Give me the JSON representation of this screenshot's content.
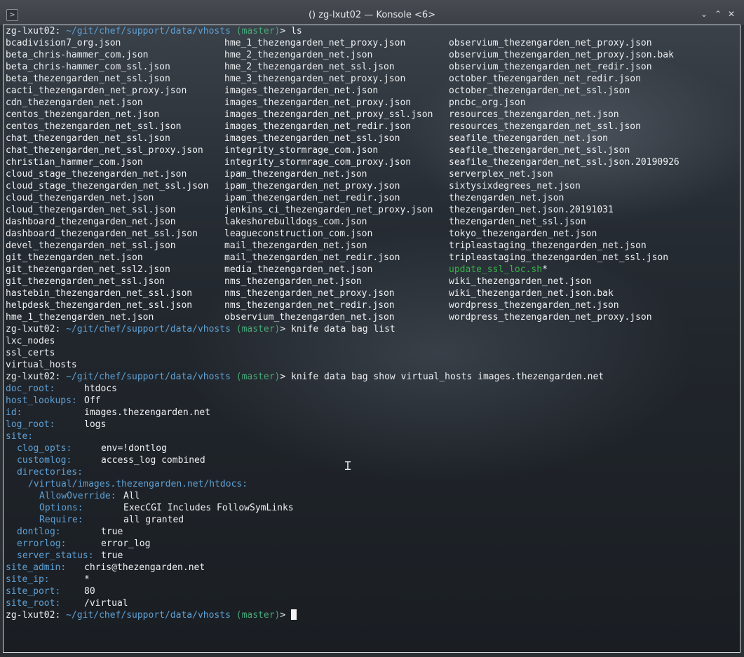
{
  "window": {
    "title": "() zg-lxut02 — Konsole <6>",
    "app_icon": "terminal-icon",
    "buttons": [
      "minimize-icon",
      "maximize-icon",
      "close-icon"
    ],
    "button_glyphs": [
      "⌄",
      "⌃",
      "✕"
    ]
  },
  "prompt": {
    "host": "zg-lxut02:",
    "path": "~/git/chef/support/data/vhosts",
    "branch": "(master)",
    "symbol": ">"
  },
  "commands": {
    "ls": "ls",
    "list": "knife data bag list",
    "show": "knife data bag show virtual_hosts images.thezengarden.net"
  },
  "ls_rows": [
    [
      "bcadivision7_org.json",
      "hme_1_thezengarden_net_proxy.json",
      "observium_thezengarden_net_proxy.json"
    ],
    [
      "beta_chris-hammer_com.json",
      "hme_2_thezengarden_net.json",
      "observium_thezengarden_net_proxy.json.bak"
    ],
    [
      "beta_chris-hammer_com_ssl.json",
      "hme_2_thezengarden_net_ssl.json",
      "observium_thezengarden_net_redir.json"
    ],
    [
      "beta_thezengarden_net_ssl.json",
      "hme_3_thezengarden_net_proxy.json",
      "october_thezengarden_net_redir.json"
    ],
    [
      "cacti_thezengarden_net_proxy.json",
      "images_thezengarden_net.json",
      "october_thezengarden_net_ssl.json"
    ],
    [
      "cdn_thezengarden_net.json",
      "images_thezengarden_net_proxy.json",
      "pncbc_org.json"
    ],
    [
      "centos_thezengarden_net.json",
      "images_thezengarden_net_proxy_ssl.json",
      "resources_thezengarden_net.json"
    ],
    [
      "centos_thezengarden_net_ssl.json",
      "images_thezengarden_net_redir.json",
      "resources_thezengarden_net_ssl.json"
    ],
    [
      "chat_thezengarden_net_ssl.json",
      "images_thezengarden_net_ssl.json",
      "seafile_thezengarden_net.json"
    ],
    [
      "chat_thezengarden_net_ssl_proxy.json",
      "integrity_stormrage_com.json",
      "seafile_thezengarden_net_ssl.json"
    ],
    [
      "christian_hammer_com.json",
      "integrity_stormrage_com_proxy.json",
      "seafile_thezengarden_net_ssl.json.20190926"
    ],
    [
      "cloud_stage_thezengarden_net.json",
      "ipam_thezengarden_net.json",
      "serverplex_net.json"
    ],
    [
      "cloud_stage_thezengarden_net_ssl.json",
      "ipam_thezengarden_net_proxy.json",
      "sixtysixdegrees_net.json"
    ],
    [
      "cloud_thezengarden_net.json",
      "ipam_thezengarden_net_redir.json",
      "thezengarden_net.json"
    ],
    [
      "cloud_thezengarden_net_ssl.json",
      "jenkins_ci_thezengarden_net_proxy.json",
      "thezengarden_net.json.20191031"
    ],
    [
      "dashboard_thezengarden_net.json",
      "lakeshorebulldogs_com.json",
      "thezengarden_net_ssl.json"
    ],
    [
      "dashboard_thezengarden_net_ssl.json",
      "leagueconstruction_com.json",
      "tokyo_thezengarden_net.json"
    ],
    [
      "devel_thezengarden_net_ssl.json",
      "mail_thezengarden_net.json",
      "tripleastaging_thezengarden_net.json"
    ],
    [
      "git_thezengarden_net.json",
      "mail_thezengarden_net_redir.json",
      "tripleastaging_thezengarden_net_ssl.json"
    ],
    [
      "git_thezengarden_net_ssl2.json",
      "media_thezengarden_net.json",
      "update_ssl_loc.sh"
    ],
    [
      "git_thezengarden_net_ssl.json",
      "nms_thezengarden_net.json",
      "wiki_thezengarden_net.json"
    ],
    [
      "hastebin_thezengarden_net_ssl.json",
      "nms_thezengarden_net_proxy.json",
      "wiki_thezengarden_net.json.bak"
    ],
    [
      "helpdesk_thezengarden_net_ssl.json",
      "nms_thezengarden_net_redir.json",
      "wordpress_thezengarden_net.json"
    ],
    [
      "hme_1_thezengarden_net.json",
      "observium_thezengarden_net.json",
      "wordpress_thezengarden_net_proxy.json"
    ]
  ],
  "exec_marker": "*",
  "data_bags": [
    "lxc_nodes",
    "ssl_certs",
    "virtual_hosts"
  ],
  "show_output": {
    "doc_root": {
      "key": "doc_root:",
      "value": "htdocs"
    },
    "host_lookups": {
      "key": "host_lookups:",
      "value": "Off"
    },
    "id": {
      "key": "id:",
      "value": "images.thezengarden.net"
    },
    "log_root": {
      "key": "log_root:",
      "value": "logs"
    },
    "site": {
      "key": "site:"
    },
    "clog_opts": {
      "key": "clog_opts:",
      "value": "env=!dontlog"
    },
    "customlog": {
      "key": "customlog:",
      "value": "access_log combined"
    },
    "directories": {
      "key": "directories:"
    },
    "dir_path": {
      "key": "/virtual/images.thezengarden.net/htdocs:"
    },
    "allow_override": {
      "key": "AllowOverride:",
      "value": "All"
    },
    "options": {
      "key": "Options:",
      "value": "ExecCGI Includes FollowSymLinks"
    },
    "require": {
      "key": "Require:",
      "value": "all granted"
    },
    "dontlog": {
      "key": "dontlog:",
      "value": "true"
    },
    "errorlog": {
      "key": "errorlog:",
      "value": "error_log"
    },
    "server_status": {
      "key": "server_status:",
      "value": "true"
    },
    "site_admin": {
      "key": "site_admin:",
      "value": "chris@thezengarden.net"
    },
    "site_ip": {
      "key": "site_ip:",
      "value": "*"
    },
    "site_port": {
      "key": "site_port:",
      "value": "80"
    },
    "site_root": {
      "key": "site_root:",
      "value": "/virtual"
    }
  },
  "colors": {
    "path": "#5ea0d4",
    "branch": "#49a97a",
    "key": "#5ea0d4",
    "executable": "#38b04a",
    "text": "#eef0f2"
  }
}
